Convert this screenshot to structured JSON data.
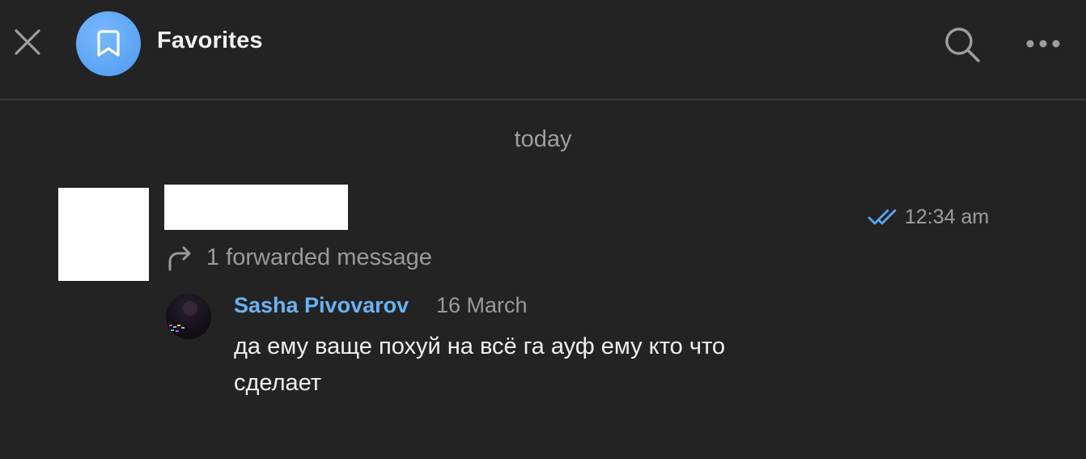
{
  "header": {
    "title": "Favorites",
    "avatar_color": "#5aa3f3",
    "close_icon": "close-icon",
    "bookmark_icon": "bookmark-icon",
    "search_icon": "search-icon",
    "more_icon": "more-horizontal-icon"
  },
  "chat": {
    "date_separator": "today",
    "message": {
      "time": "12:34 am",
      "read_status_icon": "double-check-icon",
      "read_status_color": "#5aa3f3",
      "forwarded_label": "1 forwarded message",
      "forwarded": {
        "author": "Sasha Pivovarov",
        "author_color": "#6ab2f2",
        "date": "16 March",
        "text": "да ему ваще похуй на всё га ауф ему кто что сделает"
      }
    }
  }
}
